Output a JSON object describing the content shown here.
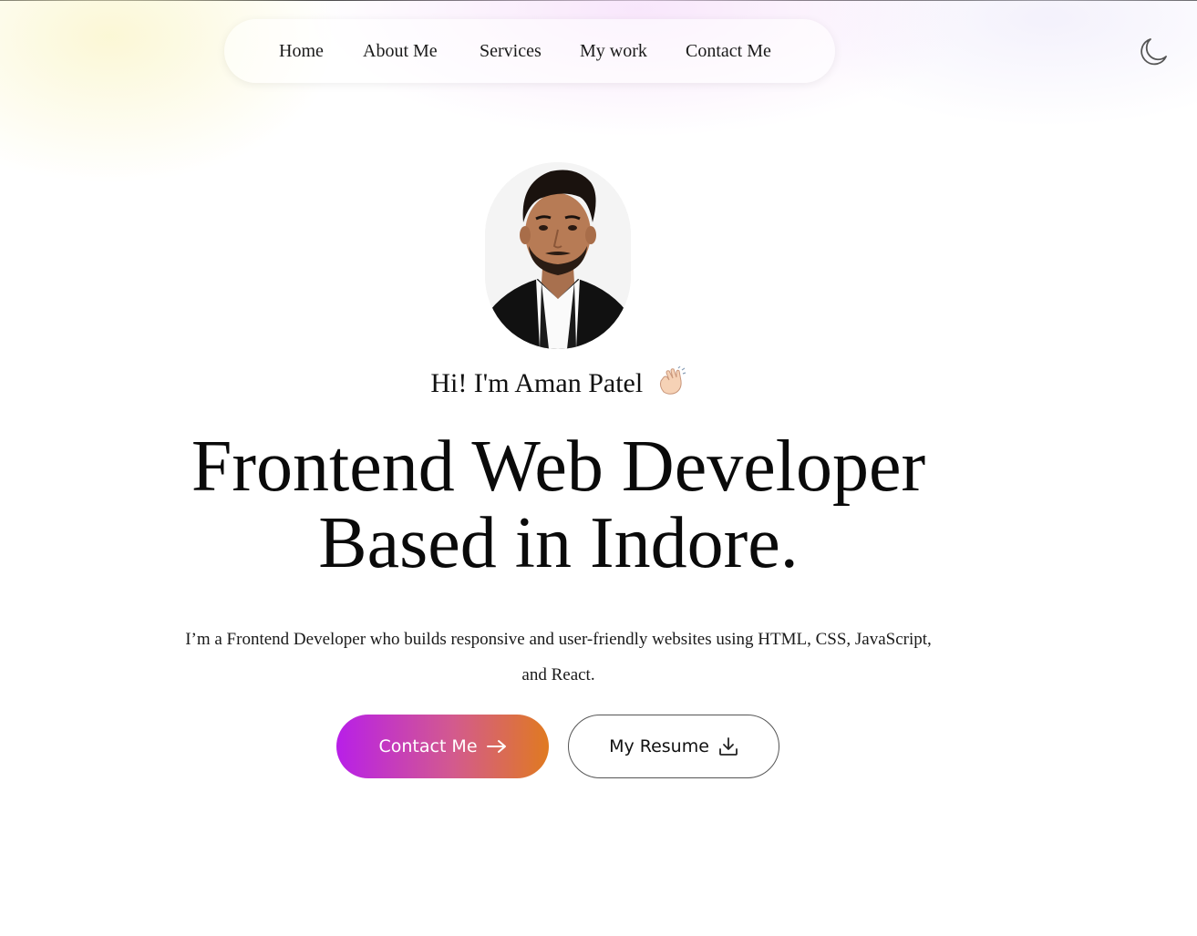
{
  "nav": {
    "items": [
      {
        "label": "Home"
      },
      {
        "label": "About Me"
      },
      {
        "label": "Services"
      },
      {
        "label": "My work"
      },
      {
        "label": "Contact Me"
      }
    ]
  },
  "theme_toggle": {
    "icon": "moon-icon"
  },
  "hero": {
    "avatar_icon": "profile-photo",
    "greeting": "Hi! I'm Aman Patel",
    "greeting_icon": "waving-hand-icon",
    "headline_line1": "Frontend Web Developer",
    "headline_line2": "Based in Indore.",
    "intro": "I’m a Frontend Developer who builds responsive and user-friendly websites using HTML, CSS, JavaScript, and React.",
    "contact_button": {
      "label": "Contact Me",
      "icon": "arrow-right-icon"
    },
    "resume_button": {
      "label": "My Resume",
      "icon": "download-icon"
    }
  },
  "colors": {
    "gradient_start": "#b81fe8",
    "gradient_end": "#e07a20",
    "text": "#111111"
  }
}
